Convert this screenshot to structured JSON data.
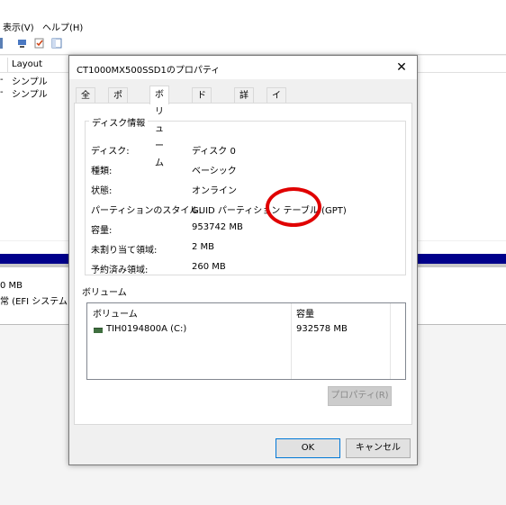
{
  "background_window": {
    "menu": {
      "view": "表示(V)",
      "help": "ヘルプ(H)"
    },
    "columns": {
      "layout": "Layout"
    },
    "rows": [
      {
        "layout": "シンプル"
      },
      {
        "layout": "シンプル"
      }
    ],
    "disk_panel": {
      "size_fragment": "0 MB",
      "status_fragment": "常 (EFI システム パ"
    }
  },
  "dialog": {
    "title": "CT1000MX500SSD1のプロパティ",
    "close_glyph": "✕",
    "tabs": [
      "全般",
      "ポリシー",
      "ボリューム",
      "ドライバー",
      "詳細",
      "イベント"
    ],
    "active_tab": "ボリューム",
    "disk_info": {
      "group_label": "ディスク情報",
      "rows": [
        {
          "label": "ディスク:",
          "value": "ディスク 0"
        },
        {
          "label": "種類:",
          "value": "ベーシック"
        },
        {
          "label": "状態:",
          "value": "オンライン"
        },
        {
          "label": "パーティションのスタイル:",
          "value": "GUID パーティション テーブル (GPT)"
        },
        {
          "label": "容量:",
          "value": "953742 MB"
        },
        {
          "label": "未割り当て領域:",
          "value": "2 MB"
        },
        {
          "label": "予約済み領域:",
          "value": "260 MB"
        }
      ]
    },
    "volumes": {
      "group_label": "ボリューム",
      "headers": {
        "volume": "ボリューム",
        "capacity": "容量"
      },
      "rows": [
        {
          "volume": "TIH0194800A (C:)",
          "capacity": "932578 MB"
        }
      ]
    },
    "properties_button": "プロパティ(R)",
    "ok_button": "OK",
    "cancel_button": "キャンセル"
  },
  "annotation": {
    "color": "#e00000"
  }
}
